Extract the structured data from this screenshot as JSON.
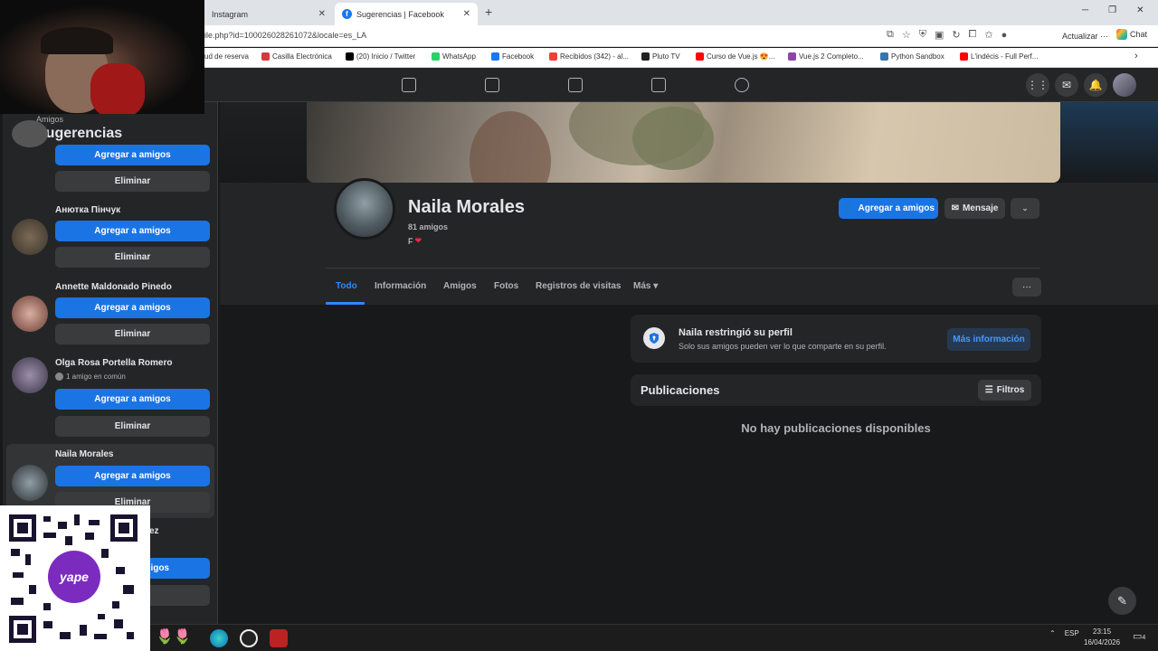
{
  "browser": {
    "tabs": [
      {
        "label": "Instagram"
      },
      {
        "label": "Sugerencias | Facebook"
      }
    ],
    "url": "ile.php?id=100026028261072&locale=es_LA",
    "update_label": "Actualizar",
    "chat_label": "Chat",
    "bookmarks": [
      {
        "label": "ud de reserva",
        "color": "#888888"
      },
      {
        "label": "Casilla Electrónica",
        "color": "#d33b3b"
      },
      {
        "label": "(20) Inicio / Twitter",
        "color": "#000000"
      },
      {
        "label": "WhatsApp",
        "color": "#25d366"
      },
      {
        "label": "Facebook",
        "color": "#1877f2"
      },
      {
        "label": "Recibidos (342) - al...",
        "color": "#ea4335"
      },
      {
        "label": "Pluto TV",
        "color": "#222222"
      },
      {
        "label": "Curso de Vue.js 😍...",
        "color": "#ff0000"
      },
      {
        "label": "Vue.js 2 Completo...",
        "color": "#8e44ad"
      },
      {
        "label": "Python Sandbox",
        "color": "#3776ab"
      },
      {
        "label": "L'indécis - Full Perf...",
        "color": "#ff0000"
      }
    ]
  },
  "sidebar": {
    "back_icon": "arrow-left-icon",
    "breadcrumb": "Amigos",
    "title": "Sugerencias",
    "add_label": "Agregar a amigos",
    "remove_label": "Eliminar",
    "suggestions": [
      {
        "name": "Анютка Пінчук",
        "mutual": ""
      },
      {
        "name": "Annette Maldonado Pinedo",
        "mutual": ""
      },
      {
        "name": "Olga Rosa Portella Romero",
        "mutual": "1 amigo en común"
      },
      {
        "name": "Naila Morales",
        "mutual": ""
      },
      {
        "name": "ez",
        "mutual": ""
      }
    ],
    "partial_add_label": "Agregar a amigos",
    "partial_remove_label": "Eliminar",
    "partial_add_tail": "igos"
  },
  "profile": {
    "name": "Naila Morales",
    "friends": "81 amigos",
    "bio": "F",
    "add_button": "Agregar a amigos",
    "message_button": "Mensaje",
    "tabs": [
      "Todo",
      "Información",
      "Amigos",
      "Fotos",
      "Registros de visitas",
      "Más"
    ],
    "active_tab": "Todo"
  },
  "restricted_card": {
    "title": "Naila restringió su perfil",
    "subtitle": "Solo sus amigos pueden ver lo que comparte en su perfil.",
    "button": "Más información"
  },
  "posts": {
    "title": "Publicaciones",
    "filters_button": "Filtros",
    "empty": "No hay publicaciones disponibles"
  },
  "taskbar": {
    "lang": "ESP",
    "time": "23:15",
    "date": "16/04/2026",
    "notif_count": "4"
  },
  "overlay": {
    "qr_brand": "yape"
  },
  "colors": {
    "fb_blue": "#1b74e4",
    "fb_link": "#2d88ff",
    "bg_dark": "#18191a",
    "card_dark": "#242526"
  }
}
